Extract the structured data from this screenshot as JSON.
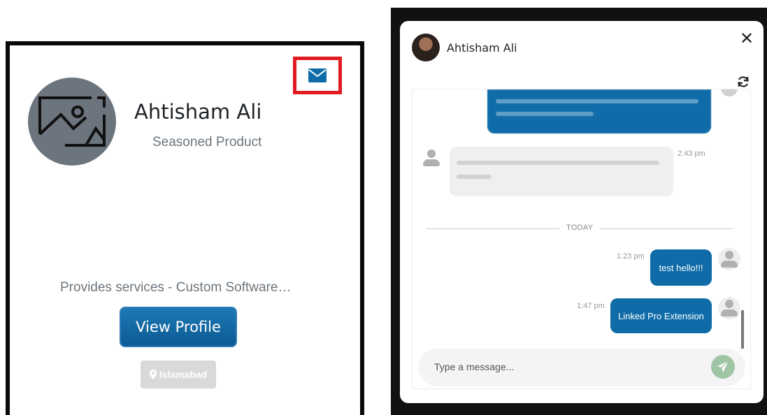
{
  "profile_card": {
    "name": "Ahtisham Ali",
    "title": "Seasoned Product",
    "description": "Provides services - Custom Software…",
    "view_profile_label": "View Profile",
    "location": "Islamabad",
    "message_icon": "envelope-icon",
    "location_icon": "map-pin-icon",
    "avatar_icon": "image-placeholder-icon"
  },
  "chat": {
    "header_name": "Ahtisham Ali",
    "close_icon": "close-icon",
    "refresh_icon": "refresh-icon",
    "incoming_time": "2:43 pm",
    "today_label": "TODAY",
    "messages": [
      {
        "time": "1:23 pm",
        "text": "test hello!!!"
      },
      {
        "time": "1:47 pm",
        "text": "Linked Pro Extension"
      }
    ],
    "input_placeholder": "Type a message...",
    "send_icon": "paper-plane-icon"
  },
  "colors": {
    "brand_blue": "#0f6ca8",
    "highlight_red": "#e11b22",
    "send_green": "#9fc5a5"
  }
}
